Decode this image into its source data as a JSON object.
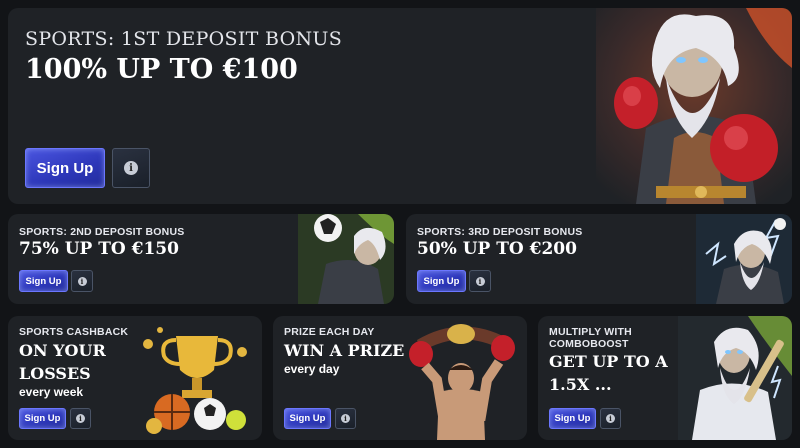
{
  "hero": {
    "subtitle": "SPORTS: 1ST DEPOSIT BONUS",
    "title": "100% UP TO €100",
    "signup_label": "Sign Up",
    "info_glyph": "i"
  },
  "promo2": {
    "subtitle": "SPORTS: 2ND DEPOSIT BONUS",
    "title": "75% UP TO €150",
    "signup_label": "Sign Up",
    "info_glyph": "i"
  },
  "promo3": {
    "subtitle": "SPORTS: 3RD DEPOSIT BONUS",
    "title": "50% UP TO €200",
    "signup_label": "Sign Up",
    "info_glyph": "i"
  },
  "cashback": {
    "subtitle": "SPORTS CASHBACK",
    "title_line1": "ON YOUR",
    "title_line2": "LOSSES",
    "extra": "every week",
    "signup_label": "Sign Up",
    "info_glyph": "i"
  },
  "prize": {
    "subtitle": "PRIZE EACH DAY",
    "title": "WIN A PRIZE",
    "extra": "every day",
    "signup_label": "Sign Up",
    "info_glyph": "i"
  },
  "combo": {
    "subtitle_line1": "MULTIPLY WITH",
    "subtitle_line2": "COMBOBOOST",
    "title_line1": "GET UP TO A",
    "title_line2": "1.5X ...",
    "signup_label": "Sign Up",
    "info_glyph": "i"
  },
  "icons": {
    "hero_art": "boxing-warrior-icon",
    "promo2_art": "football-warrior-icon",
    "promo3_art": "lightning-warrior-icon",
    "cashback_art": "trophy-balls-icon",
    "prize_art": "boxer-champion-icon",
    "combo_art": "cricket-warrior-icon",
    "info": "info-icon"
  },
  "colors": {
    "page_bg": "#121417",
    "card_bg": "#1f2226",
    "signup_blue": "#3340c8"
  }
}
